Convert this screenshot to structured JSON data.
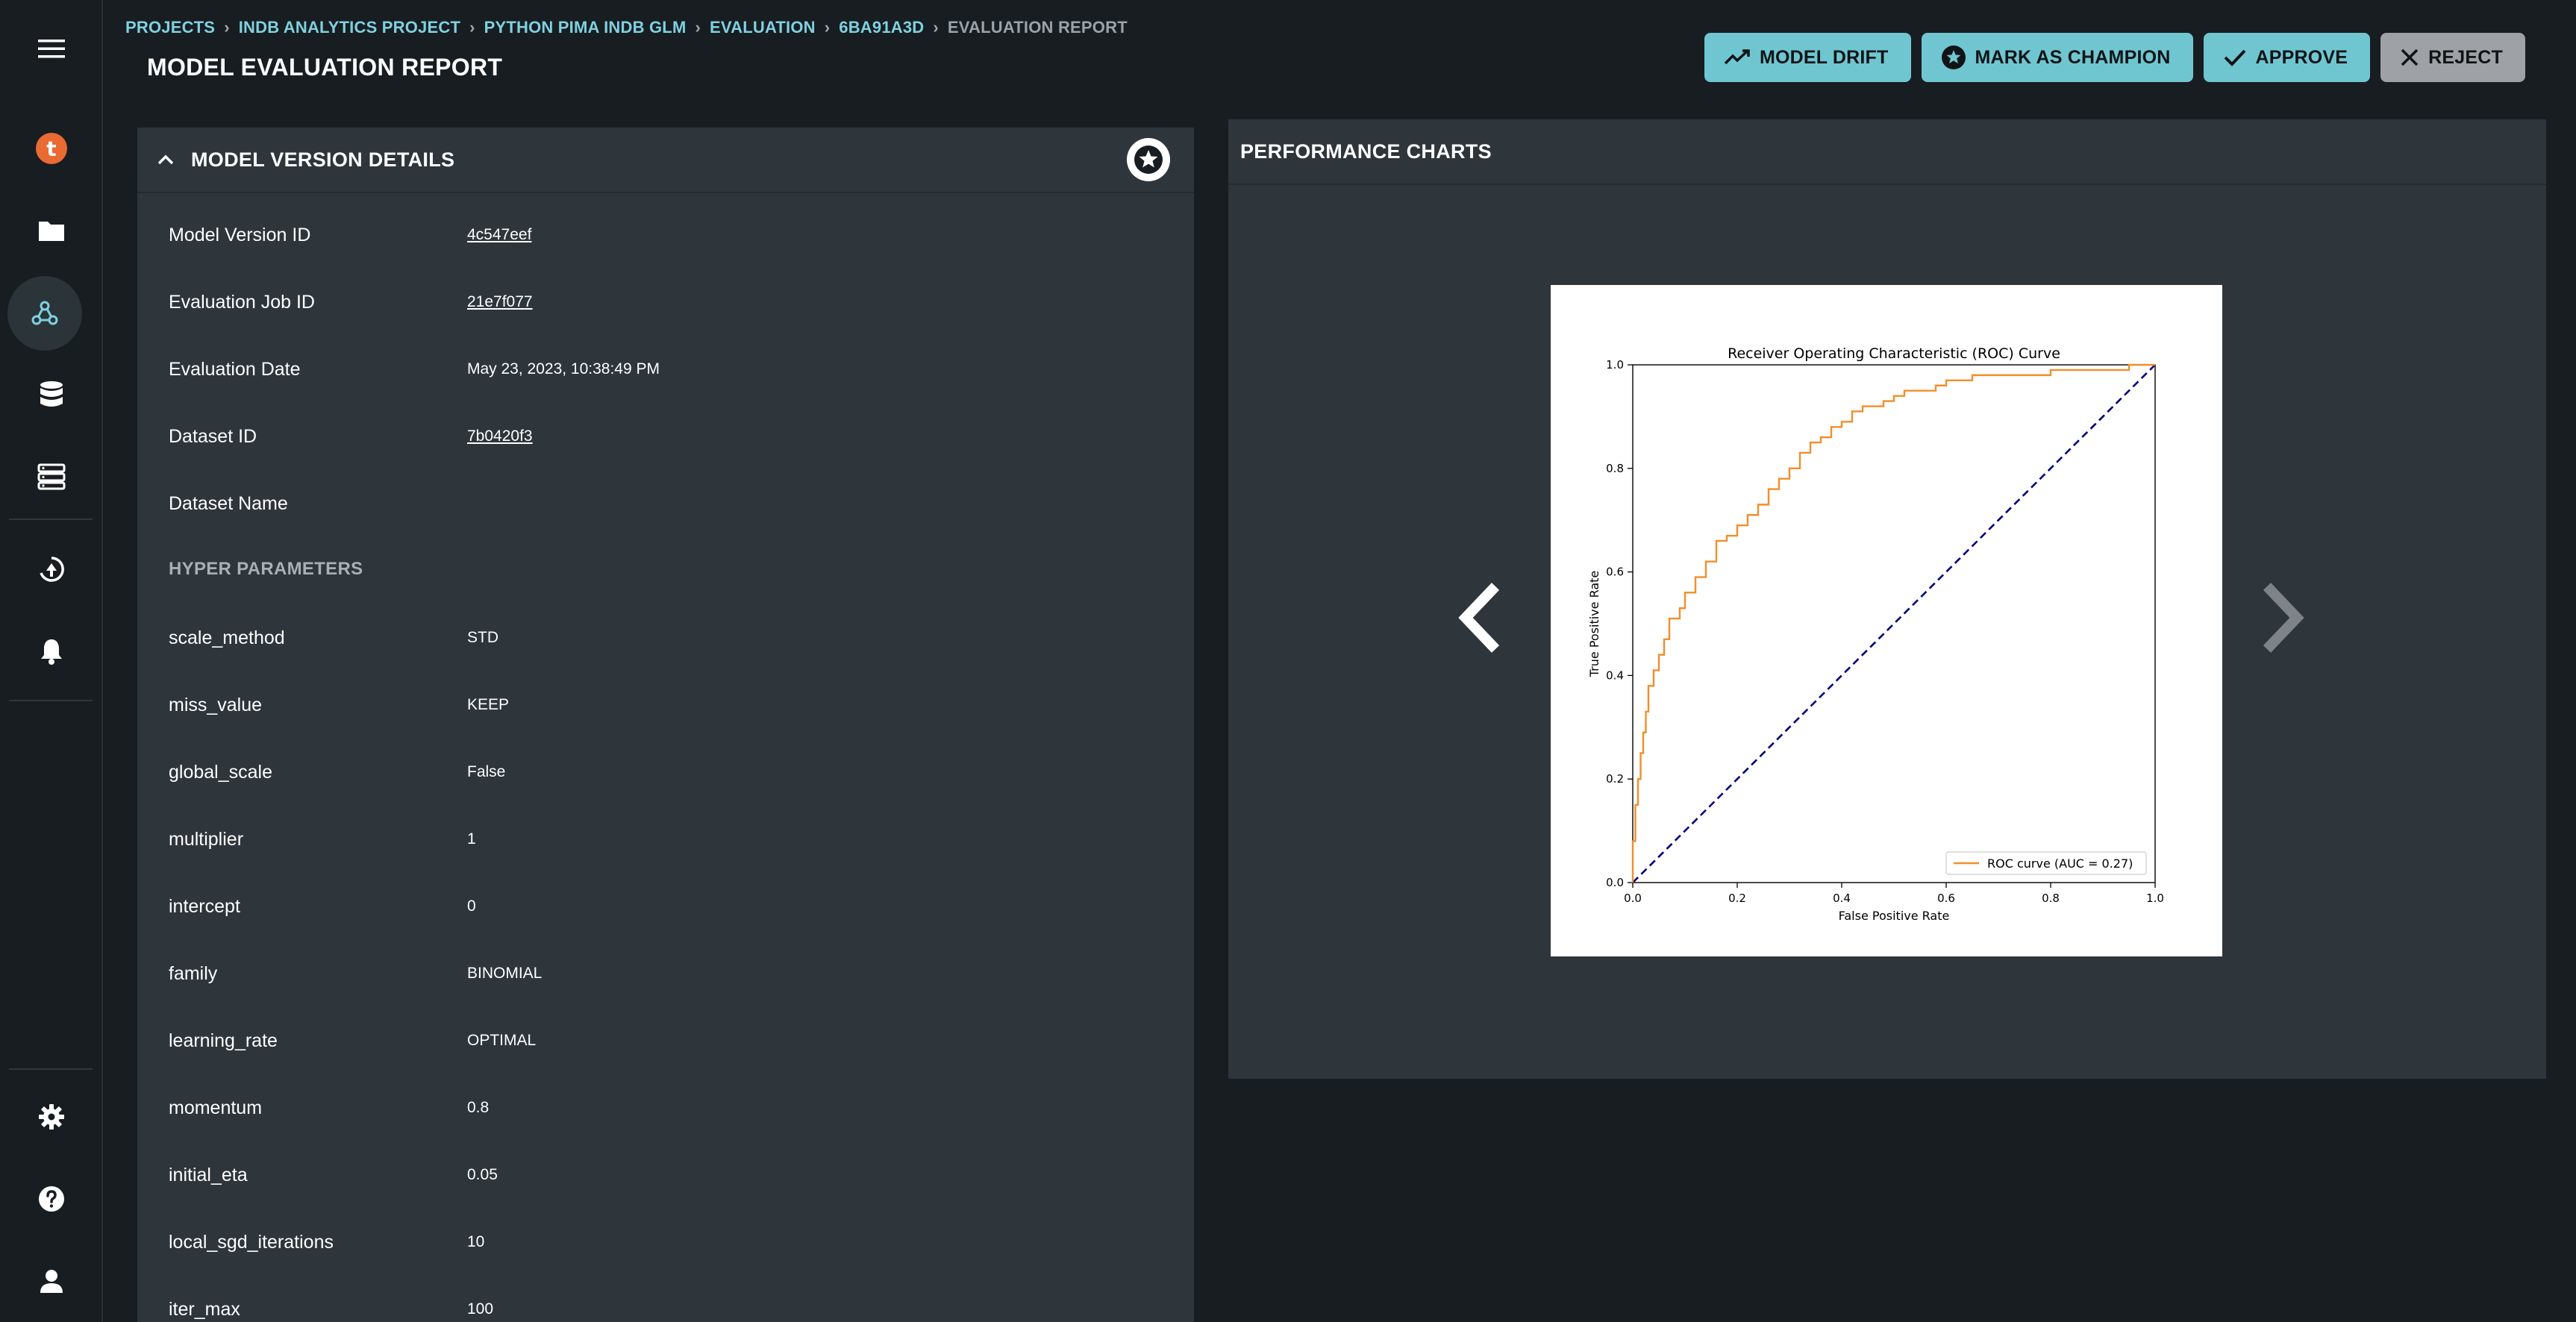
{
  "breadcrumb": [
    {
      "label": "PROJECTS"
    },
    {
      "label": "INDB ANALYTICS PROJECT"
    },
    {
      "label": "PYTHON PIMA INDB GLM"
    },
    {
      "label": "EVALUATION"
    },
    {
      "label": "6BA91A3D"
    },
    {
      "label": "EVALUATION REPORT"
    }
  ],
  "page_title": "MODEL EVALUATION REPORT",
  "actions": {
    "model_drift": "MODEL DRIFT",
    "mark_champion": "MARK AS CHAMPION",
    "approve": "APPROVE",
    "reject": "REJECT"
  },
  "details": {
    "title": "MODEL VERSION DETAILS",
    "fields": [
      {
        "label": "Model Version ID",
        "value": "4c547eef"
      },
      {
        "label": "Evaluation Job ID",
        "value": "21e7f077"
      },
      {
        "label": "Evaluation Date",
        "value": "May 23, 2023, 10:38:49 PM"
      },
      {
        "label": "Dataset ID",
        "value": "7b0420f3"
      },
      {
        "label": "Dataset Name",
        "value": ""
      }
    ],
    "hyper_label": "HYPER PARAMETERS",
    "hyper": [
      {
        "label": "scale_method",
        "value": "STD"
      },
      {
        "label": "miss_value",
        "value": "KEEP"
      },
      {
        "label": "global_scale",
        "value": "False"
      },
      {
        "label": "multiplier",
        "value": "1"
      },
      {
        "label": "intercept",
        "value": "0"
      },
      {
        "label": "family",
        "value": "BINOMIAL"
      },
      {
        "label": "learning_rate",
        "value": "OPTIMAL"
      },
      {
        "label": "momentum",
        "value": "0.8"
      },
      {
        "label": "initial_eta",
        "value": "0.05"
      },
      {
        "label": "local_sgd_iterations",
        "value": "10"
      },
      {
        "label": "iter_max",
        "value": "100"
      }
    ]
  },
  "charts": {
    "title": "PERFORMANCE CHARTS"
  },
  "icons": {
    "menu": "menu-icon",
    "brand": "t",
    "folder": "folder-icon",
    "models": "network-icon",
    "datasets": "database-icon",
    "servers": "server-icon",
    "deploy": "deploy-icon",
    "alerts": "bell-icon",
    "settings": "gear-icon",
    "help": "help-icon",
    "user": "user-icon"
  },
  "colors": {
    "accent": "#6fc6d0",
    "link": "#7fd1e0",
    "panel": "#2e353b",
    "background": "#181d21",
    "roc_curve": "#f28e2b",
    "baseline": "#000080"
  },
  "chart_data": {
    "type": "line",
    "title": "Receiver Operating Characteristic (ROC) Curve",
    "xlabel": "False Positive Rate",
    "ylabel": "True Positive Rate",
    "xlim": [
      0,
      1
    ],
    "ylim": [
      0,
      1
    ],
    "x_ticks": [
      "0.0",
      "0.2",
      "0.4",
      "0.6",
      "0.8",
      "1.0"
    ],
    "y_ticks": [
      "0.0",
      "0.2",
      "0.4",
      "0.6",
      "0.8",
      "1.0"
    ],
    "grid": false,
    "legend_position": "bottom-right",
    "series": [
      {
        "name": "ROC curve (AUC = 0.27)",
        "style": "solid",
        "x": [
          0.0,
          0.005,
          0.01,
          0.015,
          0.02,
          0.025,
          0.03,
          0.04,
          0.05,
          0.06,
          0.07,
          0.08,
          0.09,
          0.1,
          0.12,
          0.14,
          0.16,
          0.18,
          0.2,
          0.22,
          0.24,
          0.26,
          0.28,
          0.3,
          0.32,
          0.34,
          0.36,
          0.38,
          0.4,
          0.42,
          0.44,
          0.46,
          0.48,
          0.5,
          0.52,
          0.55,
          0.58,
          0.6,
          0.65,
          0.7,
          0.75,
          0.8,
          0.85,
          0.9,
          0.95,
          1.0
        ],
        "y": [
          0.0,
          0.08,
          0.15,
          0.2,
          0.25,
          0.29,
          0.33,
          0.38,
          0.41,
          0.44,
          0.47,
          0.51,
          0.51,
          0.53,
          0.56,
          0.59,
          0.62,
          0.66,
          0.67,
          0.69,
          0.71,
          0.73,
          0.76,
          0.78,
          0.8,
          0.83,
          0.85,
          0.86,
          0.88,
          0.89,
          0.91,
          0.92,
          0.92,
          0.93,
          0.94,
          0.95,
          0.95,
          0.96,
          0.97,
          0.98,
          0.98,
          0.98,
          0.99,
          0.99,
          0.99,
          1.0
        ]
      },
      {
        "name": "",
        "style": "dashed",
        "x": [
          0,
          1
        ],
        "y": [
          0,
          1
        ]
      }
    ]
  }
}
